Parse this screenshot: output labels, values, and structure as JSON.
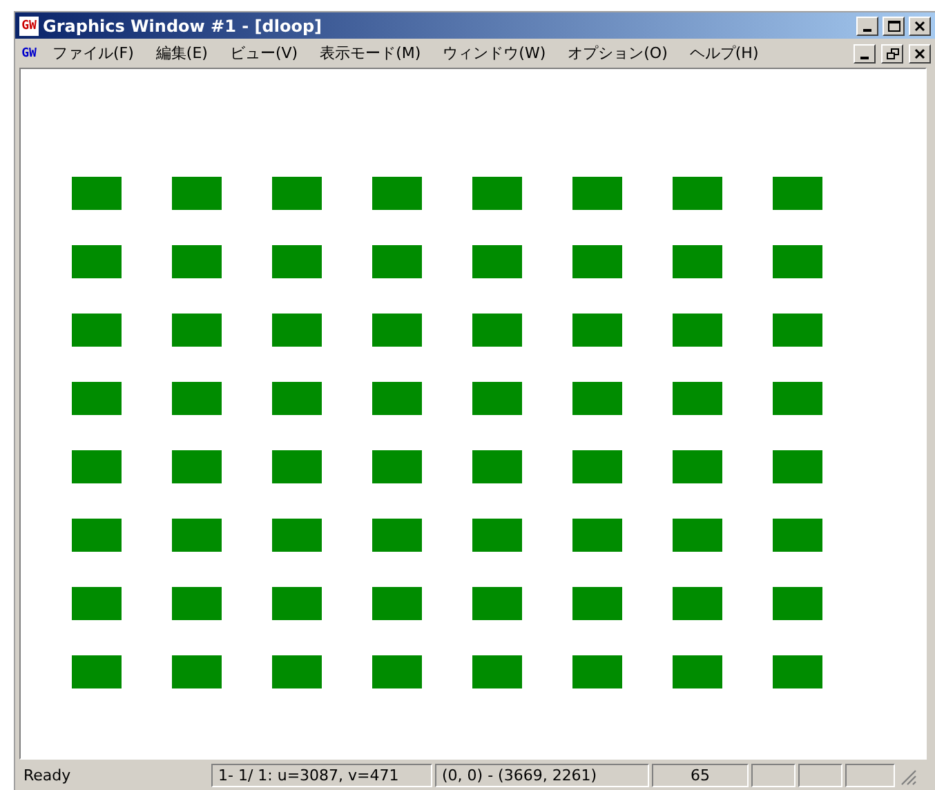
{
  "window": {
    "title": "Graphics Window #1 - [dloop]",
    "app_icon": "GW"
  },
  "menu_bar_icon": "GW",
  "menu": [
    {
      "label": "ファイル(F)"
    },
    {
      "label": "編集(E)"
    },
    {
      "label": "ビュー(V)"
    },
    {
      "label": "表示モード(M)"
    },
    {
      "label": "ウィンドウ(W)"
    },
    {
      "label": "オプション(O)"
    },
    {
      "label": "ヘルプ(H)"
    }
  ],
  "status_bar": [
    "Ready",
    "1- 1/ 1: u=3087, v=471",
    "(0, 0) - (3669, 2261)",
    "65"
  ]
}
